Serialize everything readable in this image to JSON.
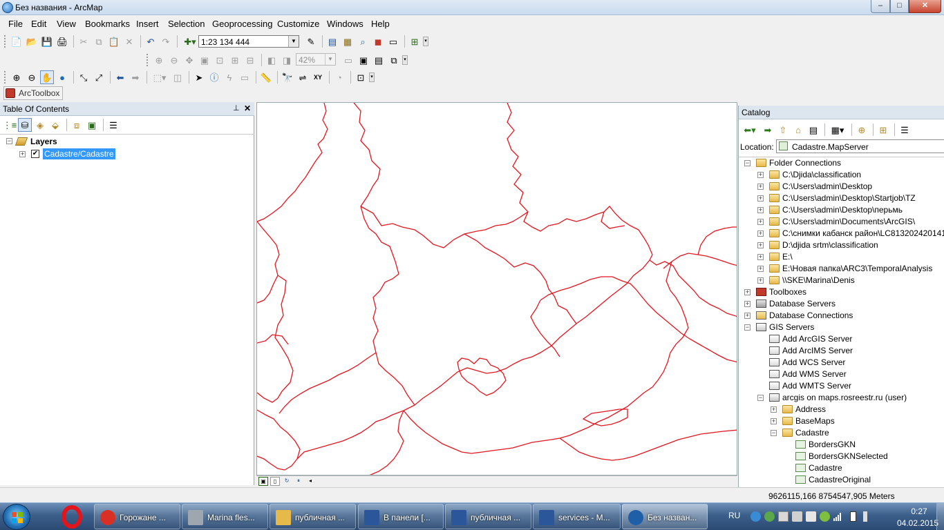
{
  "window": {
    "title": "Без названия - ArcMap",
    "controls": {
      "minimize": "–",
      "maximize": "□",
      "close": "✕"
    }
  },
  "menu": [
    "File",
    "Edit",
    "View",
    "Bookmarks",
    "Insert",
    "Selection",
    "Geoprocessing",
    "Customize",
    "Windows",
    "Help"
  ],
  "toolbars": {
    "scale_value": "1:23 134 444",
    "zoom_value": "42%",
    "arctoolbox_label": "ArcToolbox"
  },
  "toc": {
    "title": "Table Of Contents",
    "root_label": "Layers",
    "layer_label": "Cadastre/Cadastre",
    "layer_checked": true
  },
  "map": {
    "line_color": "#e8141e",
    "background": "#ffffff"
  },
  "catalog": {
    "title": "Catalog",
    "location_label": "Location:",
    "location_value": "Cadastre.MapServer",
    "tree": [
      {
        "label": "Folder Connections",
        "icon": "folder",
        "level": 0,
        "expander": "−"
      },
      {
        "label": "C:\\Djida\\classification",
        "icon": "folder",
        "level": 1,
        "expander": "+"
      },
      {
        "label": "C:\\Users\\admin\\Desktop",
        "icon": "folder",
        "level": 1,
        "expander": "+"
      },
      {
        "label": "C:\\Users\\admin\\Desktop\\Startjob\\TZ",
        "icon": "folder",
        "level": 1,
        "expander": "+"
      },
      {
        "label": "C:\\Users\\admin\\Desktop\\перьмь",
        "icon": "folder",
        "level": 1,
        "expander": "+"
      },
      {
        "label": "C:\\Users\\admin\\Documents\\ArcGIS\\",
        "icon": "folder",
        "level": 1,
        "expander": "+"
      },
      {
        "label": "C:\\снимки кабанск район\\LC813202420141",
        "icon": "folder",
        "level": 1,
        "expander": "+"
      },
      {
        "label": "D:\\djida srtm\\classification",
        "icon": "folder",
        "level": 1,
        "expander": "+"
      },
      {
        "label": "E:\\",
        "icon": "folder",
        "level": 1,
        "expander": "+"
      },
      {
        "label": "E:\\Новая папка\\ARC3\\TemporalAnalysis",
        "icon": "folder",
        "level": 1,
        "expander": "+"
      },
      {
        "label": "\\\\SKE\\Marina\\Denis",
        "icon": "folder",
        "level": 1,
        "expander": "+"
      },
      {
        "label": "Toolboxes",
        "icon": "toolbox",
        "level": 0,
        "expander": "+"
      },
      {
        "label": "Database Servers",
        "icon": "dbserver",
        "level": 0,
        "expander": "+"
      },
      {
        "label": "Database Connections",
        "icon": "dbconn",
        "level": 0,
        "expander": "+"
      },
      {
        "label": "GIS Servers",
        "icon": "gis",
        "level": 0,
        "expander": "−"
      },
      {
        "label": "Add ArcGIS Server",
        "icon": "add",
        "level": 1,
        "expander": ""
      },
      {
        "label": "Add ArcIMS Server",
        "icon": "add",
        "level": 1,
        "expander": ""
      },
      {
        "label": "Add WCS Server",
        "icon": "add",
        "level": 1,
        "expander": ""
      },
      {
        "label": "Add WMS Server",
        "icon": "add",
        "level": 1,
        "expander": ""
      },
      {
        "label": "Add WMTS Server",
        "icon": "add",
        "level": 1,
        "expander": ""
      },
      {
        "label": "arcgis on maps.rosreestr.ru (user)",
        "icon": "gis",
        "level": 1,
        "expander": "−"
      },
      {
        "label": "Address",
        "icon": "folder",
        "level": 2,
        "expander": "+"
      },
      {
        "label": "BaseMaps",
        "icon": "folder",
        "level": 2,
        "expander": "+"
      },
      {
        "label": "Cadastre",
        "icon": "folder",
        "level": 2,
        "expander": "−"
      },
      {
        "label": "BordersGKN",
        "icon": "service",
        "level": 3,
        "expander": ""
      },
      {
        "label": "BordersGKNSelected",
        "icon": "service",
        "level": 3,
        "expander": ""
      },
      {
        "label": "Cadastre",
        "icon": "service",
        "level": 3,
        "expander": ""
      },
      {
        "label": "CadastreOriginal",
        "icon": "service",
        "level": 3,
        "expander": ""
      }
    ]
  },
  "status": {
    "coordinates": "9626115,166  8754547,905 Meters"
  },
  "taskbar": {
    "tasks": [
      {
        "label": "Горожане ...",
        "icon": "chrome-icon",
        "color": "#d93025"
      },
      {
        "label": "Marina fles...",
        "icon": "drive-icon",
        "color": "#9ea7b0"
      },
      {
        "label": "публичная ...",
        "icon": "folder-icon",
        "color": "#e6b94b"
      },
      {
        "label": "В панели [...",
        "icon": "word-icon",
        "color": "#2b579a"
      },
      {
        "label": "публичная ...",
        "icon": "word-icon",
        "color": "#2b579a"
      },
      {
        "label": "services - M...",
        "icon": "word-icon",
        "color": "#2b579a"
      },
      {
        "label": "Без назван...",
        "icon": "arcmap-icon",
        "color": "#1e5fa8"
      }
    ],
    "language": "RU",
    "time": "0:27",
    "date": "04.02.2015"
  }
}
